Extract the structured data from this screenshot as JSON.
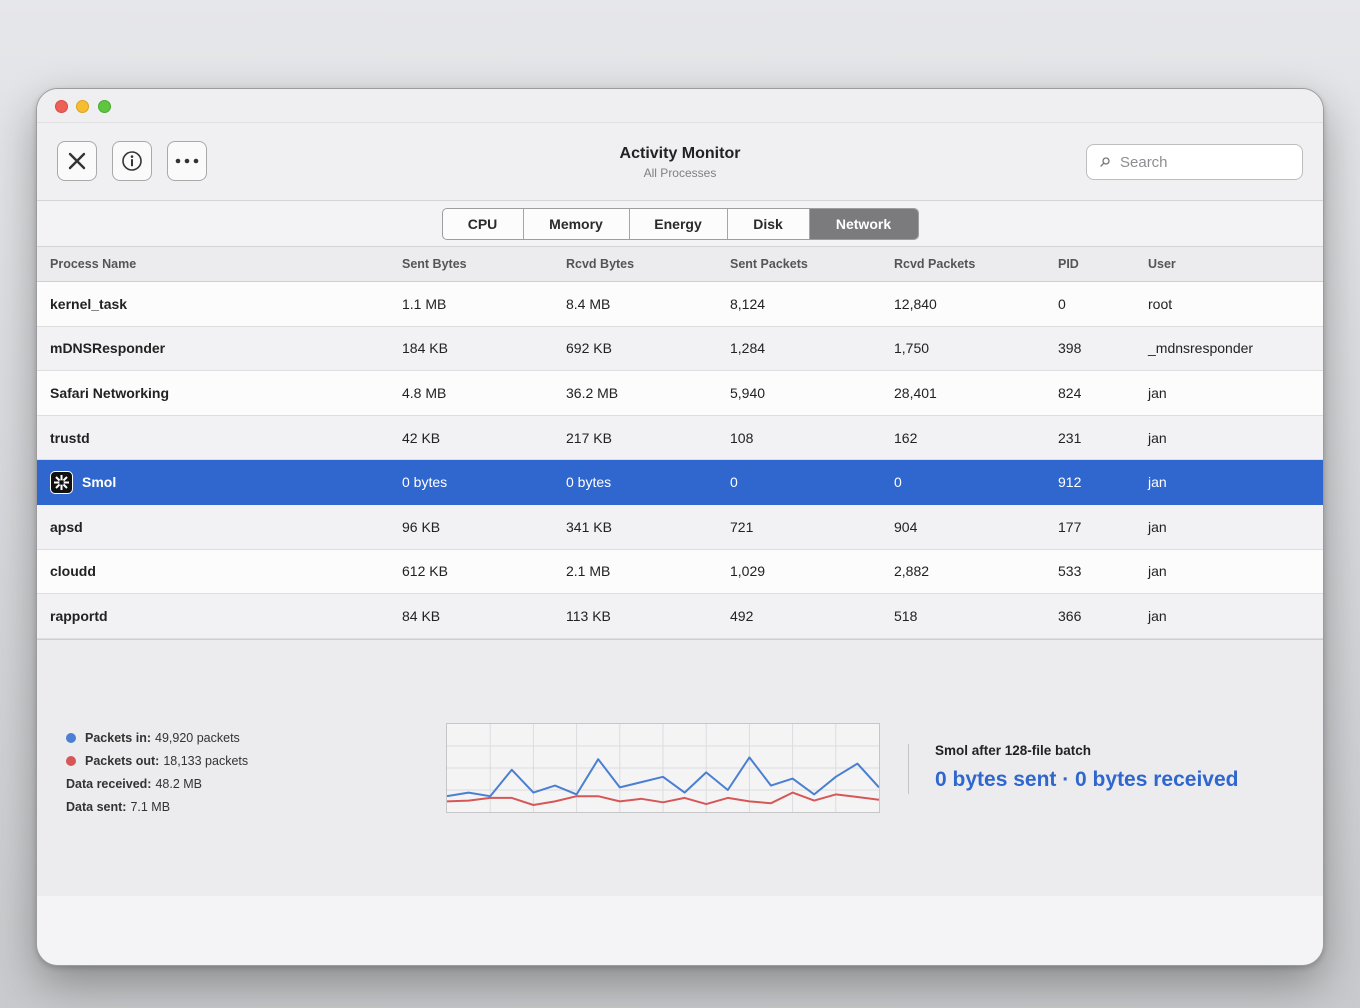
{
  "window": {
    "title": "Activity Monitor",
    "subtitle": "All Processes"
  },
  "toolbar": {
    "stop_icon": "x-icon",
    "info_icon": "info-icon",
    "more_icon": "ellipsis-icon"
  },
  "search": {
    "placeholder": "Search",
    "value": ""
  },
  "tabs": [
    {
      "label": "CPU",
      "active": false
    },
    {
      "label": "Memory",
      "active": false
    },
    {
      "label": "Energy",
      "active": false
    },
    {
      "label": "Disk",
      "active": false
    },
    {
      "label": "Network",
      "active": true
    }
  ],
  "table": {
    "columns": [
      "Process Name",
      "Sent Bytes",
      "Rcvd Bytes",
      "Sent Packets",
      "Rcvd Packets",
      "PID",
      "User"
    ],
    "rows": [
      {
        "name": "kernel_task",
        "sent_bytes": "1.1 MB",
        "rcvd_bytes": "8.4 MB",
        "sent_packets": "8,124",
        "rcvd_packets": "12,840",
        "pid": "0",
        "user": "root"
      },
      {
        "name": "mDNSResponder",
        "sent_bytes": "184 KB",
        "rcvd_bytes": "692 KB",
        "sent_packets": "1,284",
        "rcvd_packets": "1,750",
        "pid": "398",
        "user": "_mdnsresponder"
      },
      {
        "name": "Safari Networking",
        "sent_bytes": "4.8 MB",
        "rcvd_bytes": "36.2 MB",
        "sent_packets": "5,940",
        "rcvd_packets": "28,401",
        "pid": "824",
        "user": "jan"
      },
      {
        "name": "trustd",
        "sent_bytes": "42 KB",
        "rcvd_bytes": "217 KB",
        "sent_packets": "108",
        "rcvd_packets": "162",
        "pid": "231",
        "user": "jan"
      },
      {
        "name": "Smol",
        "sent_bytes": "0 bytes",
        "rcvd_bytes": "0 bytes",
        "sent_packets": "0",
        "rcvd_packets": "0",
        "pid": "912",
        "user": "jan",
        "selected": true,
        "icon": "smol-app-icon"
      },
      {
        "name": "apsd",
        "sent_bytes": "96 KB",
        "rcvd_bytes": "341 KB",
        "sent_packets": "721",
        "rcvd_packets": "904",
        "pid": "177",
        "user": "jan"
      },
      {
        "name": "cloudd",
        "sent_bytes": "612 KB",
        "rcvd_bytes": "2.1 MB",
        "sent_packets": "1,029",
        "rcvd_packets": "2,882",
        "pid": "533",
        "user": "jan"
      },
      {
        "name": "rapportd",
        "sent_bytes": "84 KB",
        "rcvd_bytes": "113 KB",
        "sent_packets": "492",
        "rcvd_packets": "518",
        "pid": "366",
        "user": "jan"
      }
    ]
  },
  "stats": {
    "packets_in_label": "Packets in:",
    "packets_in_value": "49,920 packets",
    "packets_out_label": "Packets out:",
    "packets_out_value": "18,133 packets",
    "data_received_label": "Data received:",
    "data_received_value": "48.2 MB",
    "data_sent_label": "Data sent:",
    "data_sent_value": "7.1 MB",
    "packets_in_color": "#4a7fd1",
    "packets_out_color": "#d65757"
  },
  "summary": {
    "title": "Smol after 128-file batch",
    "value": "0 bytes sent · 0 bytes received"
  },
  "chart_data": {
    "type": "line",
    "x": [
      0,
      1,
      2,
      3,
      4,
      5,
      6,
      7,
      8,
      9,
      10,
      11,
      12,
      13,
      14,
      15,
      16,
      17,
      18,
      19,
      20
    ],
    "series": [
      {
        "color": "#4a7fd1",
        "values": [
          0.18,
          0.22,
          0.18,
          0.48,
          0.22,
          0.3,
          0.2,
          0.6,
          0.28,
          0.34,
          0.4,
          0.22,
          0.45,
          0.25,
          0.62,
          0.3,
          0.38,
          0.2,
          0.4,
          0.55,
          0.28
        ]
      },
      {
        "color": "#d65757",
        "values": [
          0.12,
          0.13,
          0.16,
          0.16,
          0.08,
          0.12,
          0.18,
          0.18,
          0.12,
          0.15,
          0.11,
          0.16,
          0.09,
          0.16,
          0.12,
          0.1,
          0.22,
          0.13,
          0.2,
          0.17,
          0.14
        ]
      }
    ],
    "ylim": [
      0,
      1
    ],
    "grid": true
  }
}
